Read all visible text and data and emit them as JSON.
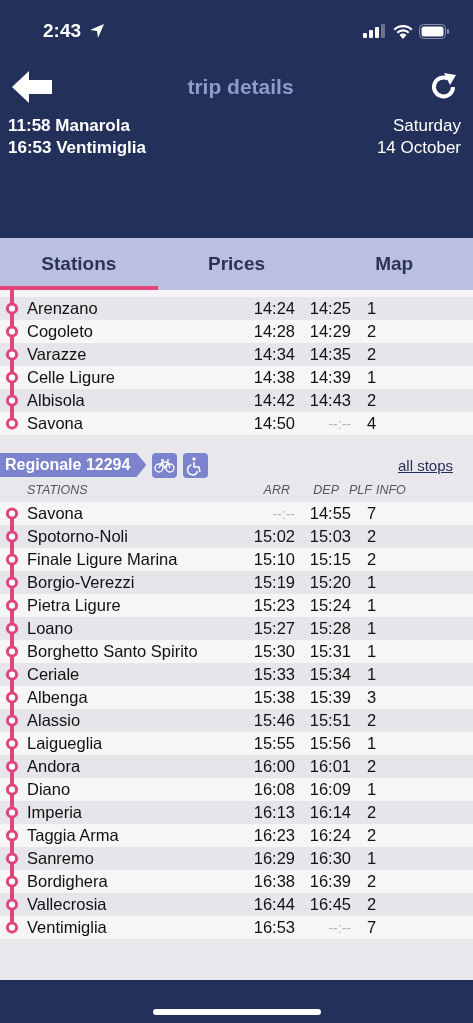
{
  "status_bar": {
    "time": "2:43"
  },
  "header": {
    "title": "trip details"
  },
  "trip": {
    "departure": "11:58 Manarola",
    "arrival": "16:53 Ventimiglia",
    "weekday": "Saturday",
    "date": "14 October"
  },
  "tabs": [
    {
      "label": "Stations",
      "selected": true
    },
    {
      "label": "Prices",
      "selected": false
    },
    {
      "label": "Map",
      "selected": false
    }
  ],
  "sections": [
    {
      "continued": true,
      "stops": [
        {
          "station": "Arenzano",
          "arr": "14:24",
          "dep": "14:25",
          "plf": "1",
          "no_arr": false,
          "no_dep": false
        },
        {
          "station": "Cogoleto",
          "arr": "14:28",
          "dep": "14:29",
          "plf": "2",
          "no_arr": false,
          "no_dep": false
        },
        {
          "station": "Varazze",
          "arr": "14:34",
          "dep": "14:35",
          "plf": "2",
          "no_arr": false,
          "no_dep": false
        },
        {
          "station": "Celle Ligure",
          "arr": "14:38",
          "dep": "14:39",
          "plf": "1",
          "no_arr": false,
          "no_dep": false
        },
        {
          "station": "Albisola",
          "arr": "14:42",
          "dep": "14:43",
          "plf": "2",
          "no_arr": false,
          "no_dep": false
        },
        {
          "station": "Savona",
          "arr": "14:50",
          "dep": "--:--",
          "plf": "4",
          "no_arr": false,
          "no_dep": true
        }
      ]
    },
    {
      "continued": false,
      "train": "Regionale 12294",
      "bike": true,
      "wheelchair": true,
      "link": "all stops",
      "columns": [
        "STATIONS",
        "ARR",
        "DEP",
        "PLF",
        "INFO"
      ],
      "stops": [
        {
          "station": "Savona",
          "arr": "--:--",
          "dep": "14:55",
          "plf": "7",
          "no_arr": true,
          "no_dep": false
        },
        {
          "station": "Spotorno-Noli",
          "arr": "15:02",
          "dep": "15:03",
          "plf": "2",
          "no_arr": false,
          "no_dep": false
        },
        {
          "station": "Finale Ligure Marina",
          "arr": "15:10",
          "dep": "15:15",
          "plf": "2",
          "no_arr": false,
          "no_dep": false
        },
        {
          "station": "Borgio-Verezzi",
          "arr": "15:19",
          "dep": "15:20",
          "plf": "1",
          "no_arr": false,
          "no_dep": false
        },
        {
          "station": "Pietra Ligure",
          "arr": "15:23",
          "dep": "15:24",
          "plf": "1",
          "no_arr": false,
          "no_dep": false
        },
        {
          "station": "Loano",
          "arr": "15:27",
          "dep": "15:28",
          "plf": "1",
          "no_arr": false,
          "no_dep": false
        },
        {
          "station": "Borghetto Santo Spirito",
          "arr": "15:30",
          "dep": "15:31",
          "plf": "1",
          "no_arr": false,
          "no_dep": false
        },
        {
          "station": "Ceriale",
          "arr": "15:33",
          "dep": "15:34",
          "plf": "1",
          "no_arr": false,
          "no_dep": false
        },
        {
          "station": "Albenga",
          "arr": "15:38",
          "dep": "15:39",
          "plf": "3",
          "no_arr": false,
          "no_dep": false
        },
        {
          "station": "Alassio",
          "arr": "15:46",
          "dep": "15:51",
          "plf": "2",
          "no_arr": false,
          "no_dep": false
        },
        {
          "station": "Laigueglia",
          "arr": "15:55",
          "dep": "15:56",
          "plf": "1",
          "no_arr": false,
          "no_dep": false
        },
        {
          "station": "Andora",
          "arr": "16:00",
          "dep": "16:01",
          "plf": "2",
          "no_arr": false,
          "no_dep": false
        },
        {
          "station": "Diano",
          "arr": "16:08",
          "dep": "16:09",
          "plf": "1",
          "no_arr": false,
          "no_dep": false
        },
        {
          "station": "Imperia",
          "arr": "16:13",
          "dep": "16:14",
          "plf": "2",
          "no_arr": false,
          "no_dep": false
        },
        {
          "station": "Taggia Arma",
          "arr": "16:23",
          "dep": "16:24",
          "plf": "2",
          "no_arr": false,
          "no_dep": false
        },
        {
          "station": "Sanremo",
          "arr": "16:29",
          "dep": "16:30",
          "plf": "1",
          "no_arr": false,
          "no_dep": false
        },
        {
          "station": "Bordighera",
          "arr": "16:38",
          "dep": "16:39",
          "plf": "2",
          "no_arr": false,
          "no_dep": false
        },
        {
          "station": "Vallecrosia",
          "arr": "16:44",
          "dep": "16:45",
          "plf": "2",
          "no_arr": false,
          "no_dep": false
        },
        {
          "station": "Ventimiglia",
          "arr": "16:53",
          "dep": "--:--",
          "plf": "7",
          "no_arr": false,
          "no_dep": true
        }
      ]
    }
  ]
}
